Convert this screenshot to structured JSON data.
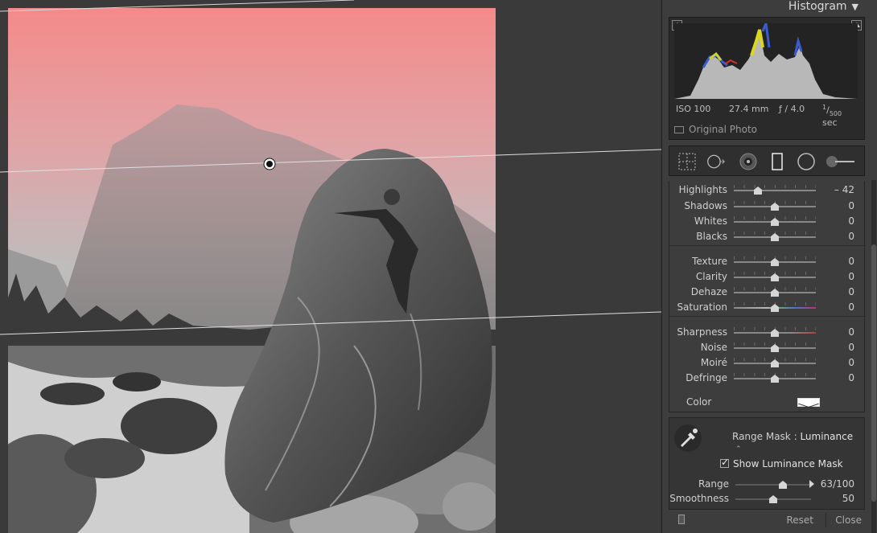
{
  "histogram": {
    "title": "Histogram",
    "iso": "ISO 100",
    "focal": "27.4 mm",
    "aperture": "ƒ / 4.0",
    "shutter_num": "1",
    "shutter_den": "500",
    "shutter_unit": "sec",
    "original_photo": "Original Photo"
  },
  "tools": [
    "crop-grid-icon",
    "spot-removal-icon",
    "red-eye-icon",
    "graduated-filter-icon",
    "radial-filter-icon",
    "adjustment-brush-icon"
  ],
  "sliders": [
    {
      "label": "Highlights",
      "value": "– 42",
      "pos": 0.29
    },
    {
      "label": "Shadows",
      "value": "0",
      "pos": 0.5
    },
    {
      "label": "Whites",
      "value": "0",
      "pos": 0.5
    },
    {
      "label": "Blacks",
      "value": "0",
      "pos": 0.5
    },
    {
      "label": "Texture",
      "value": "0",
      "pos": 0.5
    },
    {
      "label": "Clarity",
      "value": "0",
      "pos": 0.5
    },
    {
      "label": "Dehaze",
      "value": "0",
      "pos": 0.5
    },
    {
      "label": "Saturation",
      "value": "0",
      "pos": 0.5
    },
    {
      "label": "Sharpness",
      "value": "0",
      "pos": 0.5
    },
    {
      "label": "Noise",
      "value": "0",
      "pos": 0.5
    },
    {
      "label": "Moiré",
      "value": "0",
      "pos": 0.5
    },
    {
      "label": "Defringe",
      "value": "0",
      "pos": 0.5
    }
  ],
  "color_label": "Color",
  "mask": {
    "label": "Range Mask :",
    "mode": "Luminance",
    "mode_arrow": "⌃",
    "show_label": "Show Luminance Mask",
    "range_label": "Range",
    "range_value": "63/100",
    "smoothness_label": "Smoothness",
    "smoothness_value": "50"
  },
  "buttons": {
    "reset": "Reset",
    "close": "Close"
  },
  "colors": {
    "overlay": "#ff5a5a",
    "accent": "#d8d8d8"
  }
}
